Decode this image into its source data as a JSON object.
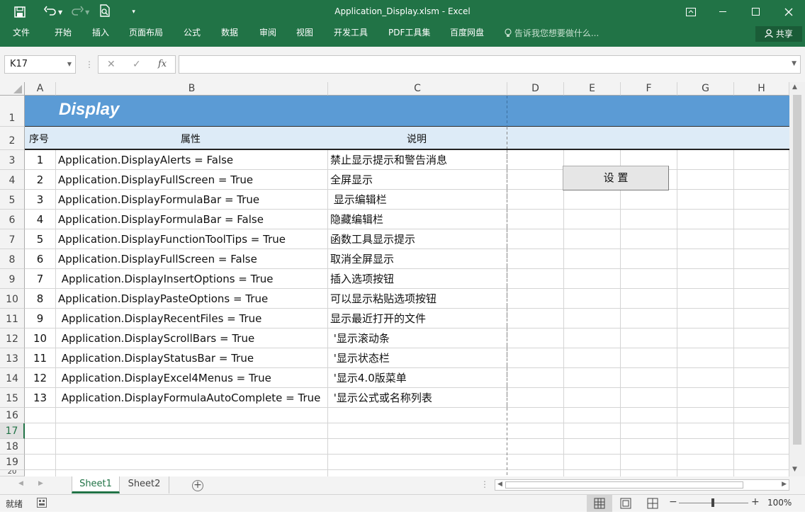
{
  "window": {
    "title": "Application_Display.xlsm - Excel"
  },
  "quick_access": {
    "save": "save-icon",
    "undo": "undo-icon",
    "redo": "redo-icon",
    "preview": "print-preview-icon",
    "customize": "customize-icon"
  },
  "ribbon_tabs": [
    "文件",
    "开始",
    "插入",
    "页面布局",
    "公式",
    "数据",
    "审阅",
    "视图",
    "开发工具",
    "PDF工具集",
    "百度网盘"
  ],
  "tell_me": "告诉我您想要做什么...",
  "share": "共享",
  "name_box": "K17",
  "formula_value": "",
  "fx_label": "fx",
  "columns": [
    "A",
    "B",
    "C",
    "D",
    "E",
    "F",
    "G",
    "H"
  ],
  "rows": [
    "1",
    "2",
    "3",
    "4",
    "5",
    "6",
    "7",
    "8",
    "9",
    "10",
    "11",
    "12",
    "13",
    "14",
    "15",
    "16",
    "17",
    "18",
    "19",
    "20"
  ],
  "sheet": {
    "banner": "Display",
    "headers": {
      "index": "序号",
      "property": "属性",
      "desc": "说明"
    },
    "data": [
      {
        "idx": "1",
        "prop": "Application.DisplayAlerts = False",
        "desc": "禁止显示提示和警告消息"
      },
      {
        "idx": "2",
        "prop": "Application.DisplayFullScreen = True",
        "desc": "全屏显示"
      },
      {
        "idx": "3",
        "prop": "Application.DisplayFormulaBar = True",
        "desc": " 显示编辑栏"
      },
      {
        "idx": "4",
        "prop": "Application.DisplayFormulaBar = False",
        "desc": "隐藏编辑栏"
      },
      {
        "idx": "5",
        "prop": "Application.DisplayFunctionToolTips = True",
        "desc": "函数工具显示提示"
      },
      {
        "idx": "6",
        "prop": "Application.DisplayFullScreen = False",
        "desc": "取消全屏显示"
      },
      {
        "idx": "7",
        "prop": " Application.DisplayInsertOptions = True",
        "desc": "插入选项按钮"
      },
      {
        "idx": "8",
        "prop": "Application.DisplayPasteOptions = True",
        "desc": "可以显示粘贴选项按钮"
      },
      {
        "idx": "9",
        "prop": " Application.DisplayRecentFiles = True",
        "desc": "显示最近打开的文件"
      },
      {
        "idx": "10",
        "prop": " Application.DisplayScrollBars = True",
        "desc": " '显示滚动条"
      },
      {
        "idx": "11",
        "prop": " Application.DisplayStatusBar = True",
        "desc": " '显示状态栏"
      },
      {
        "idx": "12",
        "prop": " Application.DisplayExcel4Menus = True",
        "desc": " '显示4.0版菜单"
      },
      {
        "idx": "13",
        "prop": " Application.DisplayFormulaAutoComplete = True",
        "desc": " '显示公式或名称列表"
      }
    ],
    "button_label": "设 置"
  },
  "sheet_tabs": [
    "Sheet1",
    "Sheet2"
  ],
  "active_sheet": "Sheet1",
  "status": {
    "ready": "就绪",
    "zoom": "100%"
  },
  "colors": {
    "excel_green": "#217346",
    "banner_blue": "#5b9bd5",
    "header_light_blue": "#ddebf7"
  }
}
